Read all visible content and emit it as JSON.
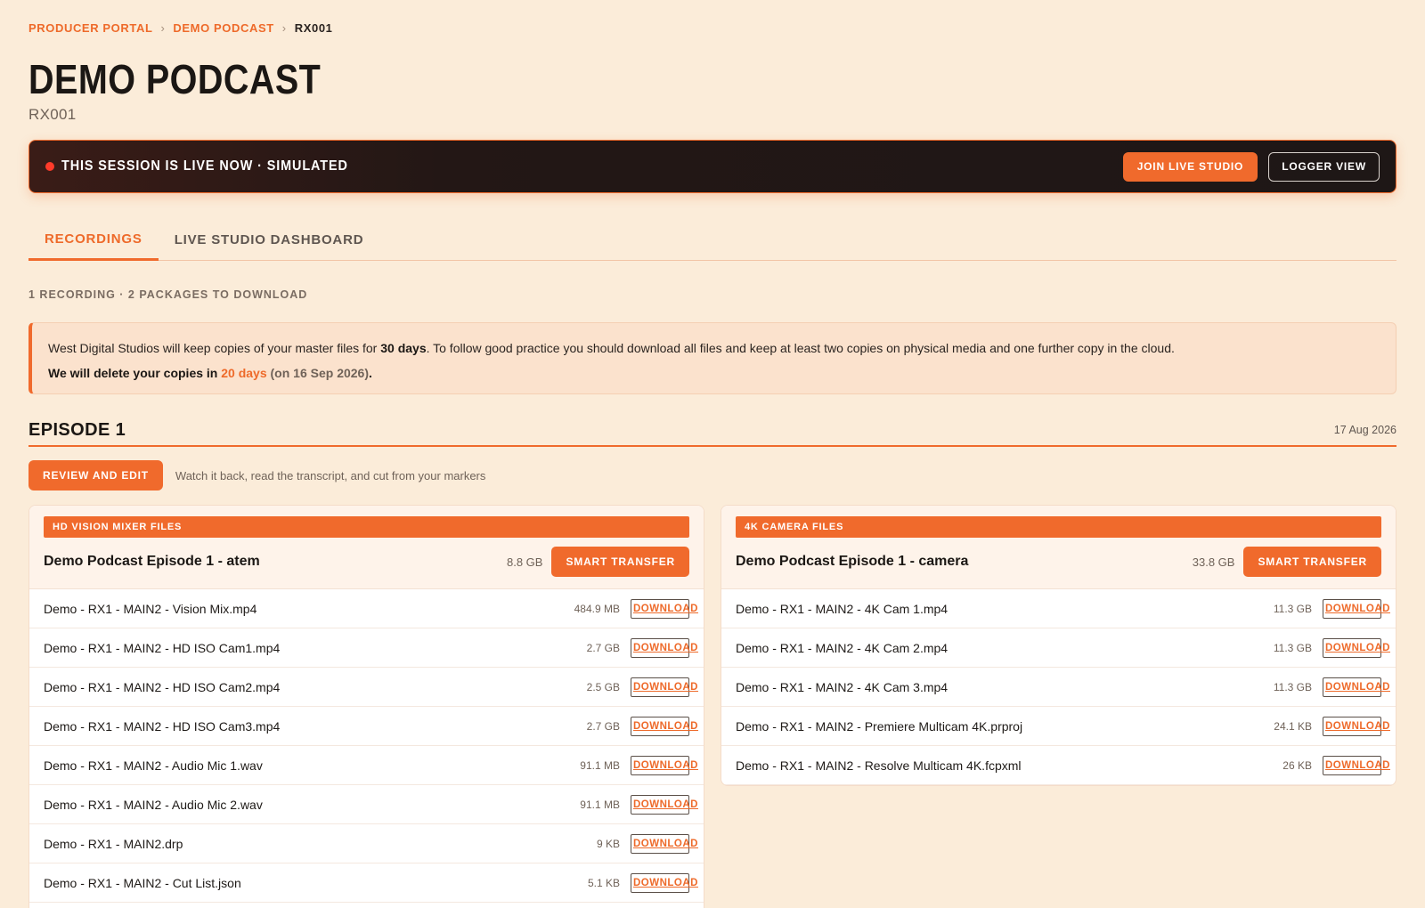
{
  "breadcrumb": {
    "items": [
      "PRODUCER PORTAL",
      "DEMO PODCAST"
    ],
    "current": "RX001",
    "separator": "›"
  },
  "page": {
    "title": "DEMO PODCAST",
    "subtitle": "RX001"
  },
  "live": {
    "status": "THIS SESSION IS LIVE NOW · SIMULATED",
    "join_label": "JOIN LIVE STUDIO",
    "logger_label": "LOGGER VIEW"
  },
  "tabs": [
    {
      "label": "RECORDINGS",
      "active": true
    },
    {
      "label": "LIVE STUDIO DASHBOARD",
      "active": false
    }
  ],
  "summary": "1 RECORDING · 2 PACKAGES TO DOWNLOAD",
  "notice": {
    "l1_a": "West Digital Studios will keep copies of your master files for ",
    "l1_b": "30 days",
    "l1_c": ". To follow good practice you should download all files and keep at least two copies on physical media and one further copy in the cloud.",
    "l2_a": "We will delete your copies in ",
    "l2_b": "20 days",
    "l2_c": "(on 16 Sep 2026)",
    "l2_d": "."
  },
  "episode": {
    "title": "EPISODE 1",
    "date": "17 Aug 2026",
    "review_label": "REVIEW AND EDIT",
    "review_hint": "Watch it back, read the transcript, and cut from your markers"
  },
  "download_label": "DOWNLOAD",
  "packages": [
    {
      "badge": "HD VISION MIXER FILES",
      "title": "Demo Podcast Episode 1 - atem",
      "size": "8.8 GB",
      "transfer_label": "SMART TRANSFER",
      "files": [
        {
          "name": "Demo - RX1 - MAIN2 - Vision Mix.mp4",
          "size": "484.9 MB"
        },
        {
          "name": "Demo - RX1 - MAIN2 - HD ISO Cam1.mp4",
          "size": "2.7 GB"
        },
        {
          "name": "Demo - RX1 - MAIN2 - HD ISO Cam2.mp4",
          "size": "2.5 GB"
        },
        {
          "name": "Demo - RX1 - MAIN2 - HD ISO Cam3.mp4",
          "size": "2.7 GB"
        },
        {
          "name": "Demo - RX1 - MAIN2 - Audio Mic 1.wav",
          "size": "91.1 MB"
        },
        {
          "name": "Demo - RX1 - MAIN2 - Audio Mic 2.wav",
          "size": "91.1 MB"
        },
        {
          "name": "Demo - RX1 - MAIN2.drp",
          "size": "9 KB"
        },
        {
          "name": "Demo - RX1 - MAIN2 - Cut List.json",
          "size": "5.1 KB"
        }
      ]
    },
    {
      "badge": "4K CAMERA FILES",
      "title": "Demo Podcast Episode 1 - camera",
      "size": "33.8 GB",
      "transfer_label": "SMART TRANSFER",
      "files": [
        {
          "name": "Demo - RX1 - MAIN2 - 4K Cam 1.mp4",
          "size": "11.3 GB"
        },
        {
          "name": "Demo - RX1 - MAIN2 - 4K Cam 2.mp4",
          "size": "11.3 GB"
        },
        {
          "name": "Demo - RX1 - MAIN2 - 4K Cam 3.mp4",
          "size": "11.3 GB"
        },
        {
          "name": "Demo - RX1 - MAIN2 - Premiere Multicam 4K.prproj",
          "size": "24.1 KB"
        },
        {
          "name": "Demo - RX1 - MAIN2 - Resolve Multicam 4K.fcpxml",
          "size": "26 KB"
        }
      ]
    }
  ],
  "colors": {
    "accent": "#f06a2c",
    "background": "#fbecd9",
    "live_dot": "#ff3b2a"
  }
}
